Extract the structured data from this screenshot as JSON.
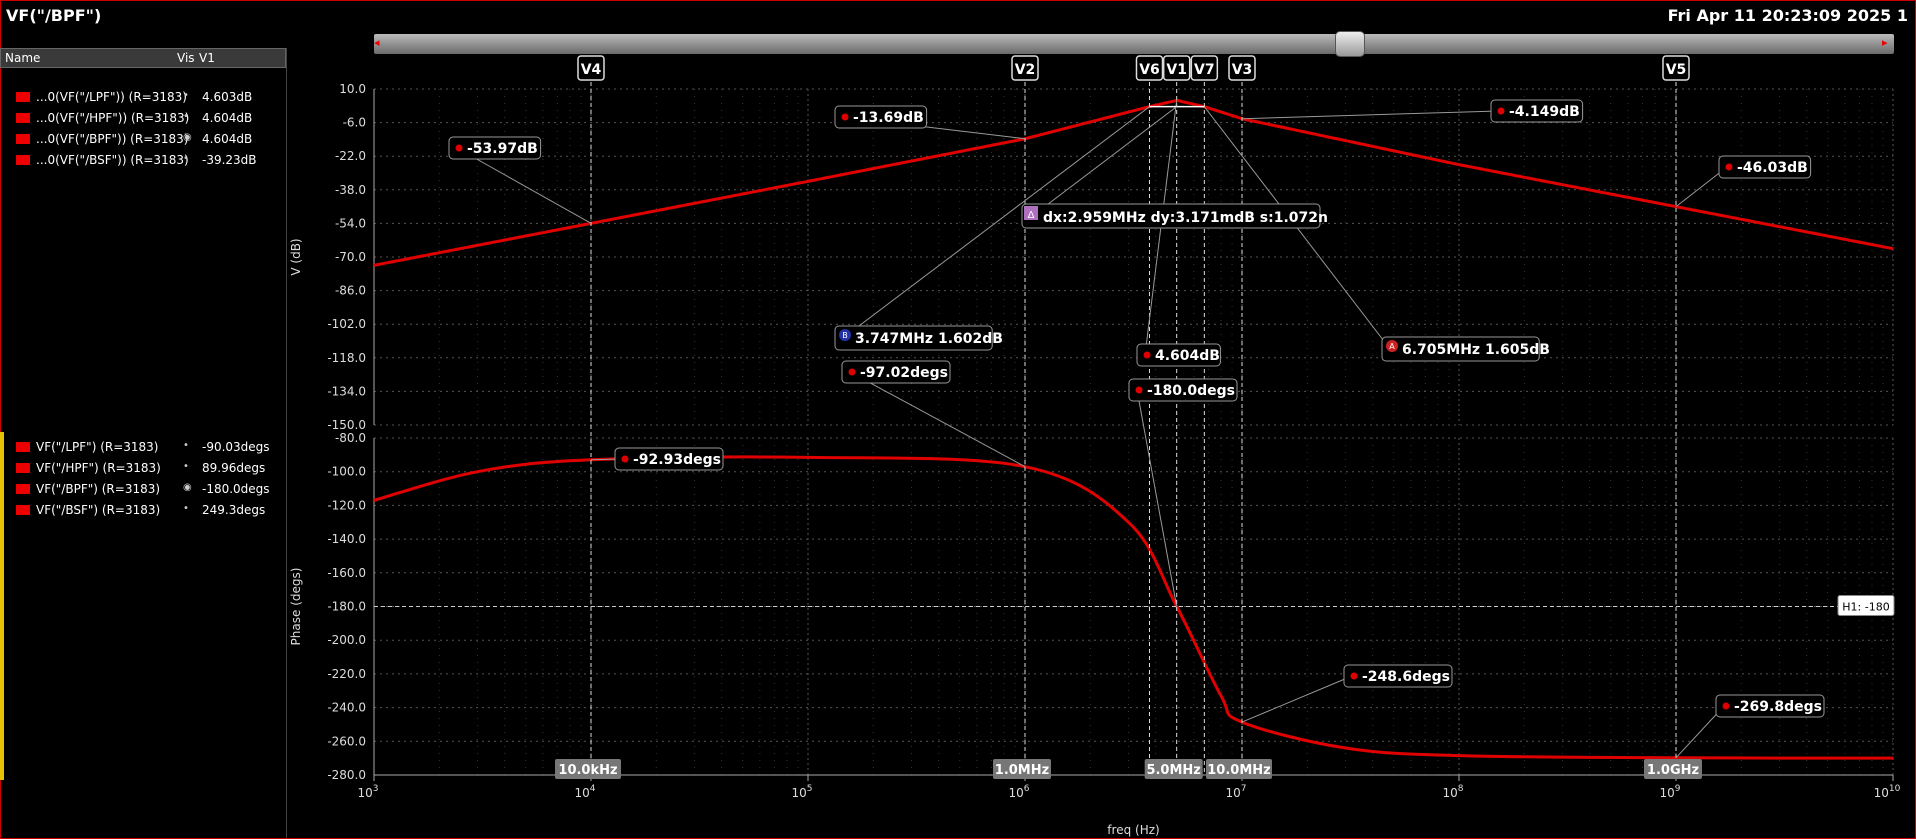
{
  "window": {
    "title": "VF(\"/BPF\")",
    "timestamp": "Fri Apr 11 20:23:09 2025  1"
  },
  "legend": {
    "headers": {
      "name": "Name",
      "vis": "Vis",
      "value": "V1"
    },
    "magnitude_rows": [
      {
        "name": "...0(VF(\"/LPF\")) (R=3183)",
        "value": "4.603dB",
        "visible_icon": "dot-icon"
      },
      {
        "name": "...0(VF(\"/HPF\")) (R=3183)",
        "value": "4.604dB",
        "visible_icon": "dot-icon"
      },
      {
        "name": "...0(VF(\"/BPF\")) (R=3183)",
        "value": "4.604dB",
        "visible_icon": "eye-icon"
      },
      {
        "name": "...0(VF(\"/BSF\")) (R=3183)",
        "value": "-39.23dB",
        "visible_icon": "dot-icon"
      }
    ],
    "phase_rows": [
      {
        "name": "VF(\"/LPF\") (R=3183)",
        "value": "-90.03degs",
        "visible_icon": "dot-icon"
      },
      {
        "name": "VF(\"/HPF\") (R=3183)",
        "value": "89.96degs",
        "visible_icon": "dot-icon"
      },
      {
        "name": "VF(\"/BPF\") (R=3183)",
        "value": "-180.0degs",
        "visible_icon": "eye-icon"
      },
      {
        "name": "VF(\"/BSF\") (R=3183)",
        "value": "249.3degs",
        "visible_icon": "dot-icon"
      }
    ]
  },
  "colors": {
    "trace": "#e00000",
    "grid": "#555555",
    "background": "#000000",
    "accent": "#e6c300"
  },
  "chart_data": [
    {
      "type": "line",
      "ylabel": "V (dB)",
      "xlabel": "freq (Hz)",
      "x_scale": "log",
      "xlim": [
        1000,
        10000000000
      ],
      "ylim": [
        -150,
        10
      ],
      "yticks": [
        "10.0",
        "-6.0",
        "-22.0",
        "-38.0",
        "-54.0",
        "-70.0",
        "-86.0",
        "-102.0",
        "-118.0",
        "-134.0",
        "-150.0"
      ],
      "grid": true,
      "series": [
        {
          "x": [
            1000,
            10000,
            100000,
            1000000,
            3747000,
            5000000,
            6705000,
            10000000,
            100000000,
            1000000000,
            10000000000
          ],
          "values": [
            -73.97,
            -53.97,
            -33.97,
            -13.69,
            1.602,
            4.604,
            1.605,
            -4.149,
            -26.03,
            -46.03,
            -66.03
          ]
        }
      ]
    },
    {
      "type": "line",
      "ylabel": "Phase (degs)",
      "xlabel": "freq (Hz)",
      "x_scale": "log",
      "xlim": [
        1000,
        10000000000
      ],
      "ylim": [
        -280,
        -80
      ],
      "yticks": [
        "-80.0",
        "-100.0",
        "-120.0",
        "-140.0",
        "-160.0",
        "-180.0",
        "-200.0",
        "-220.0",
        "-240.0",
        "-260.0",
        "-280.0"
      ],
      "grid": true,
      "series": [
        {
          "x": [
            1000,
            3000,
            10000,
            100000,
            1000000,
            3000000,
            5000000,
            8000000,
            10000000,
            30000000,
            100000000,
            1000000000,
            10000000000
          ],
          "values": [
            -117,
            -100,
            -92.93,
            -91.5,
            -97.02,
            -130,
            -180.0,
            -233,
            -248.6,
            -264,
            -268.5,
            -269.8,
            -270
          ]
        }
      ]
    }
  ],
  "x_tick_labels": [
    {
      "base": "10",
      "exp": "3",
      "value": 1000
    },
    {
      "base": "10",
      "exp": "4",
      "value": 10000
    },
    {
      "base": "10",
      "exp": "5",
      "value": 100000
    },
    {
      "base": "10",
      "exp": "6",
      "value": 1000000
    },
    {
      "base": "10",
      "exp": "7",
      "value": 10000000
    },
    {
      "base": "10",
      "exp": "8",
      "value": 100000000
    },
    {
      "base": "10",
      "exp": "9",
      "value": 1000000000
    },
    {
      "base": "10",
      "exp": "10",
      "value": 10000000000
    }
  ],
  "vertical_markers": [
    {
      "label": "V4",
      "freq": 10000,
      "freq_label": "10.0kHz"
    },
    {
      "label": "V2",
      "freq": 1000000,
      "freq_label": "1.0MHz"
    },
    {
      "label": "V6",
      "freq": 3747000,
      "freq_label": ""
    },
    {
      "label": "V1",
      "freq": 5000000,
      "freq_label": "5.0MHz"
    },
    {
      "label": "V7",
      "freq": 6705000,
      "freq_label": ""
    },
    {
      "label": "V3",
      "freq": 10000000,
      "freq_label": "10.0MHz"
    },
    {
      "label": "V5",
      "freq": 1000000000,
      "freq_label": "1.0GHz"
    }
  ],
  "horizontal_marker": {
    "label": "H1: -180",
    "value": -180
  },
  "mag_labels": [
    {
      "text": "-53.97dB",
      "freq": 10000,
      "value": -53.97
    },
    {
      "text": "-13.69dB",
      "freq": 1000000,
      "value": -13.69
    },
    {
      "text": "-4.149dB",
      "freq": 10000000,
      "value": -4.149
    },
    {
      "text": "-46.03dB",
      "freq": 1000000000,
      "value": -46.03
    },
    {
      "text": "4.604dB",
      "freq": 5000000,
      "value": 4.604
    }
  ],
  "phase_labels": [
    {
      "text": "-92.93degs",
      "freq": 10000,
      "value": -92.93
    },
    {
      "text": "-97.02degs",
      "freq": 1000000,
      "value": -97.02
    },
    {
      "text": "-248.6degs",
      "freq": 10000000,
      "value": -248.6
    },
    {
      "text": "-269.8degs",
      "freq": 1000000000,
      "value": -269.8
    },
    {
      "text": "-180.0degs",
      "freq": 5000000,
      "value": -180.0
    }
  ],
  "points": {
    "A": {
      "badge": "A",
      "text": "6.705MHz 1.605dB"
    },
    "B": {
      "badge": "B",
      "text": "3.747MHz 1.602dB"
    },
    "delta": {
      "badge": "Δ",
      "text": "dx:2.959MHz dy:3.171mdB s:1.072n"
    }
  }
}
